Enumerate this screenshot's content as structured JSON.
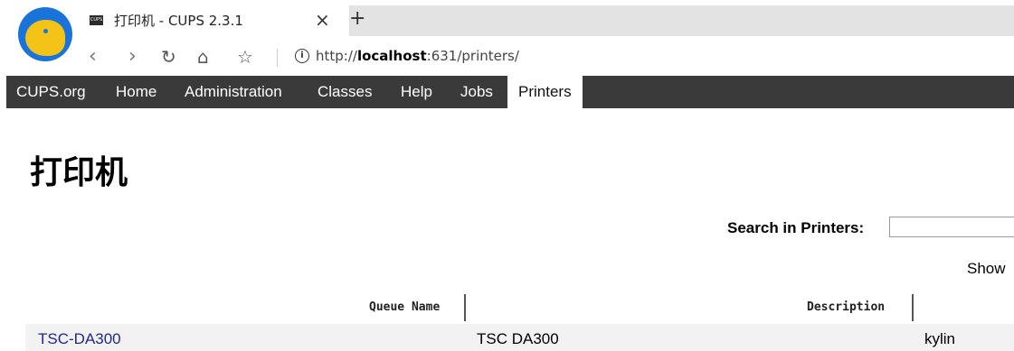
{
  "browser": {
    "tab_title": "打印机 - CUPS 2.3.1",
    "favicon_text": "CUPS",
    "close_glyph": "×",
    "new_tab_glyph": "+",
    "url_prefix": "http://",
    "url_host": "localhost",
    "url_rest": ":631/printers/"
  },
  "nav": {
    "items": [
      "CUPS.org",
      "Home",
      "Administration",
      "Classes",
      "Help",
      "Jobs",
      "Printers"
    ],
    "active": "Printers"
  },
  "page": {
    "heading": "打印机",
    "search_label": "Search in Printers:",
    "search_value": "",
    "show_label": "Show"
  },
  "table": {
    "headers": [
      "Queue Name",
      "Description"
    ],
    "rows": [
      {
        "queue": "TSC-DA300",
        "description": "TSC DA300",
        "location": "kylin"
      }
    ]
  },
  "colors": {
    "nav_bg": "#3a3a3a",
    "link": "#1e2a8c",
    "tabstrip": "#e3e3e3"
  }
}
